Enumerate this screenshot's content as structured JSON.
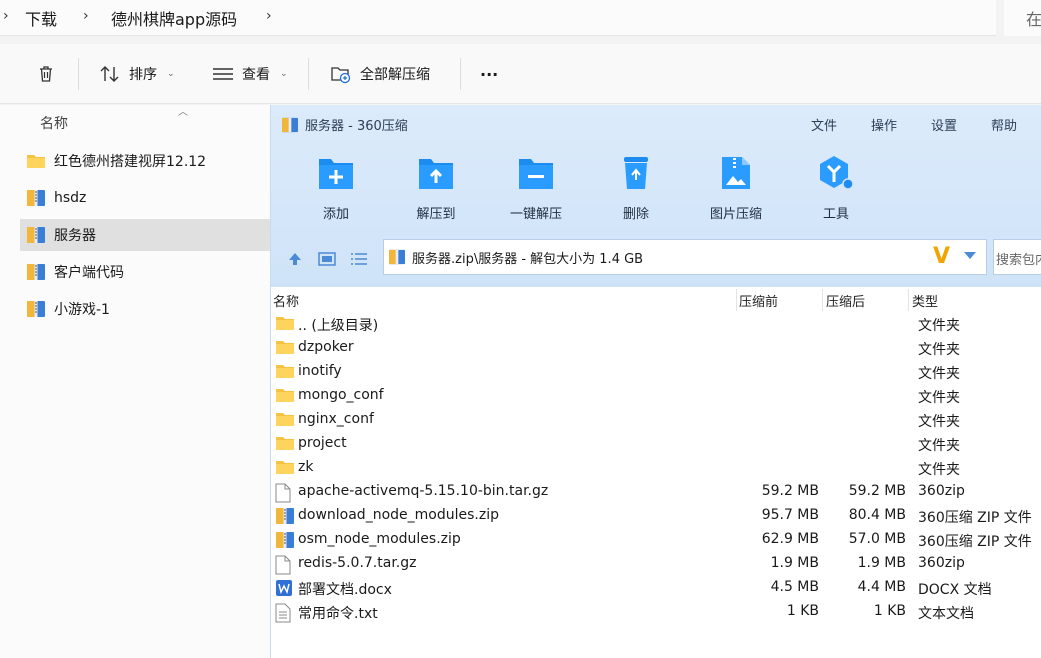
{
  "address": {
    "crumbs": [
      "下载",
      "德州棋牌app源码"
    ],
    "search_placeholder": "在"
  },
  "commands": {
    "sort_label": "排序",
    "view_label": "查看",
    "extract_all_label": "全部解压缩",
    "more_label": "···"
  },
  "nav": {
    "header": "名称",
    "items": [
      {
        "label": "红色德州搭建视屏12.12",
        "icon": "folder-icon"
      },
      {
        "label": "hsdz",
        "icon": "zip-archive-icon"
      },
      {
        "label": "服务器",
        "icon": "zip-archive-icon"
      },
      {
        "label": "客户端代码",
        "icon": "zip-archive-icon"
      },
      {
        "label": "小游戏-1",
        "icon": "zip-archive-icon"
      }
    ]
  },
  "zip": {
    "title": "服务器 - 360压缩",
    "menu": [
      "文件",
      "操作",
      "设置",
      "帮助"
    ],
    "tools": [
      "添加",
      "解压到",
      "一键解压",
      "删除",
      "图片压缩",
      "工具"
    ],
    "path": "服务器.zip\\服务器 - 解包大小为 1.4 GB",
    "search_placeholder": "搜索包内",
    "columns": {
      "name": "名称",
      "compressed_before": "压缩前",
      "compressed_after": "压缩后",
      "type": "类型"
    },
    "files": [
      {
        "name": ".. (上级目录)",
        "before": "",
        "after": "",
        "type": "文件夹",
        "icon": "folder-icon"
      },
      {
        "name": "dzpoker",
        "before": "",
        "after": "",
        "type": "文件夹",
        "icon": "folder-icon"
      },
      {
        "name": "inotify",
        "before": "",
        "after": "",
        "type": "文件夹",
        "icon": "folder-icon"
      },
      {
        "name": "mongo_conf",
        "before": "",
        "after": "",
        "type": "文件夹",
        "icon": "folder-icon"
      },
      {
        "name": "nginx_conf",
        "before": "",
        "after": "",
        "type": "文件夹",
        "icon": "folder-icon"
      },
      {
        "name": "project",
        "before": "",
        "after": "",
        "type": "文件夹",
        "icon": "folder-icon"
      },
      {
        "name": "zk",
        "before": "",
        "after": "",
        "type": "文件夹",
        "icon": "folder-icon"
      },
      {
        "name": "apache-activemq-5.15.10-bin.tar.gz",
        "before": "59.2 MB",
        "after": "59.2 MB",
        "type": "360zip",
        "icon": "file-icon"
      },
      {
        "name": "download_node_modules.zip",
        "before": "95.7 MB",
        "after": "80.4 MB",
        "type": "360压缩 ZIP 文件",
        "icon": "zip-archive-icon"
      },
      {
        "name": "osm_node_modules.zip",
        "before": "62.9 MB",
        "after": "57.0 MB",
        "type": "360压缩 ZIP 文件",
        "icon": "zip-archive-icon"
      },
      {
        "name": "redis-5.0.7.tar.gz",
        "before": "1.9 MB",
        "after": "1.9 MB",
        "type": "360zip",
        "icon": "file-icon"
      },
      {
        "name": "部署文档.docx",
        "before": "4.5 MB",
        "after": "4.4 MB",
        "type": "DOCX 文档",
        "icon": "word-doc-icon"
      },
      {
        "name": "常用命令.txt",
        "before": "1 KB",
        "after": "1 KB",
        "type": "文本文档",
        "icon": "text-file-icon"
      }
    ]
  }
}
